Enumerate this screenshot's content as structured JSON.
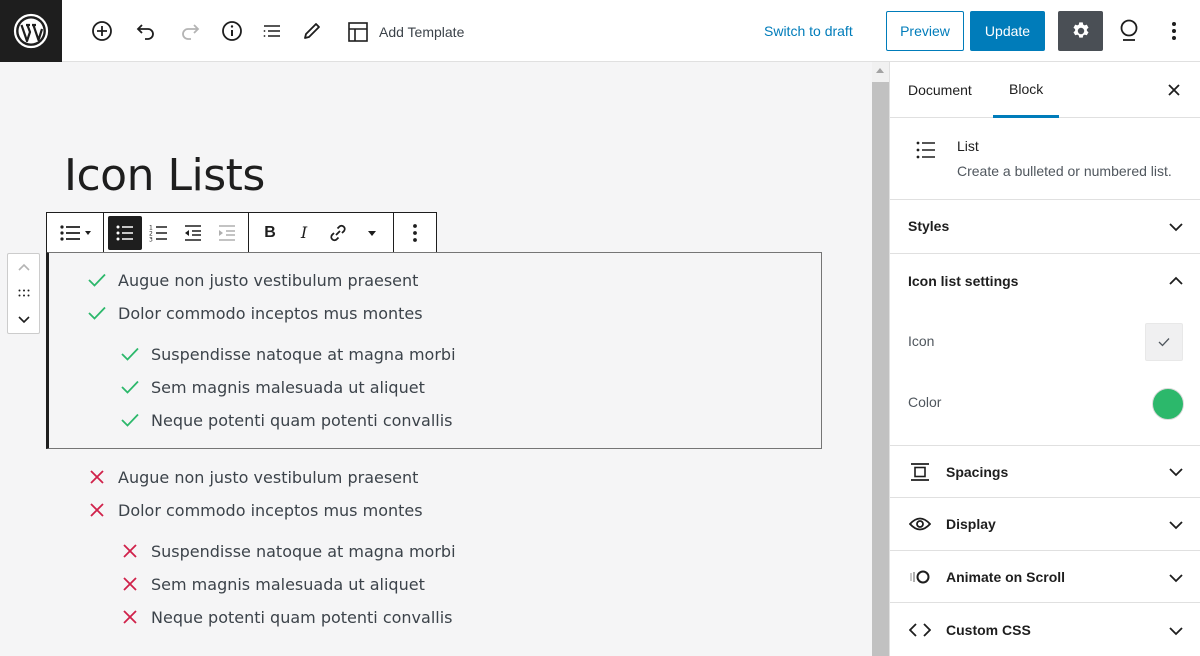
{
  "topbar": {
    "add_template_label": "Add Template",
    "switch_to_draft_label": "Switch to draft",
    "preview_label": "Preview",
    "update_label": "Update"
  },
  "editor": {
    "title": "Icon Lists",
    "block_toolbar": {
      "buttons": [
        "list-style",
        "unordered-list",
        "ordered-list",
        "outdent",
        "indent",
        "bold",
        "italic",
        "link",
        "more-rich-text",
        "block-options"
      ],
      "bold_label": "B",
      "italic_label": "I"
    },
    "check_list": {
      "icon": "check-icon",
      "color": "#2cb86b",
      "items": [
        {
          "text": "Augue non justo vestibulum praesent",
          "level": 0
        },
        {
          "text": "Dolor commodo inceptos mus montes",
          "level": 0
        },
        {
          "text": "Suspendisse natoque at magna morbi",
          "level": 1
        },
        {
          "text": "Sem magnis malesuada ut aliquet",
          "level": 1
        },
        {
          "text": "Neque potenti quam potenti convallis",
          "level": 1
        }
      ]
    },
    "cross_list": {
      "icon": "cross-icon",
      "color": "#d0214a",
      "items": [
        {
          "text": "Augue non justo vestibulum praesent",
          "level": 0
        },
        {
          "text": "Dolor commodo inceptos mus montes",
          "level": 0
        },
        {
          "text": "Suspendisse natoque at magna morbi",
          "level": 1
        },
        {
          "text": "Sem magnis malesuada ut aliquet",
          "level": 1
        },
        {
          "text": "Neque potenti quam potenti convallis",
          "level": 1
        }
      ]
    }
  },
  "sidebar": {
    "tabs": [
      {
        "label": "Document",
        "active": false
      },
      {
        "label": "Block",
        "active": true
      }
    ],
    "block": {
      "name": "List",
      "description": "Create a bulleted or numbered list."
    },
    "panels": {
      "styles": "Styles",
      "icon_list_settings": "Icon list settings",
      "spacings": "Spacings",
      "display": "Display",
      "animate_on_scroll": "Animate on Scroll",
      "custom_css": "Custom CSS"
    },
    "settings": {
      "icon_label": "Icon",
      "icon_value": "check-icon",
      "color_label": "Color",
      "color_value": "#2cb86b"
    }
  }
}
